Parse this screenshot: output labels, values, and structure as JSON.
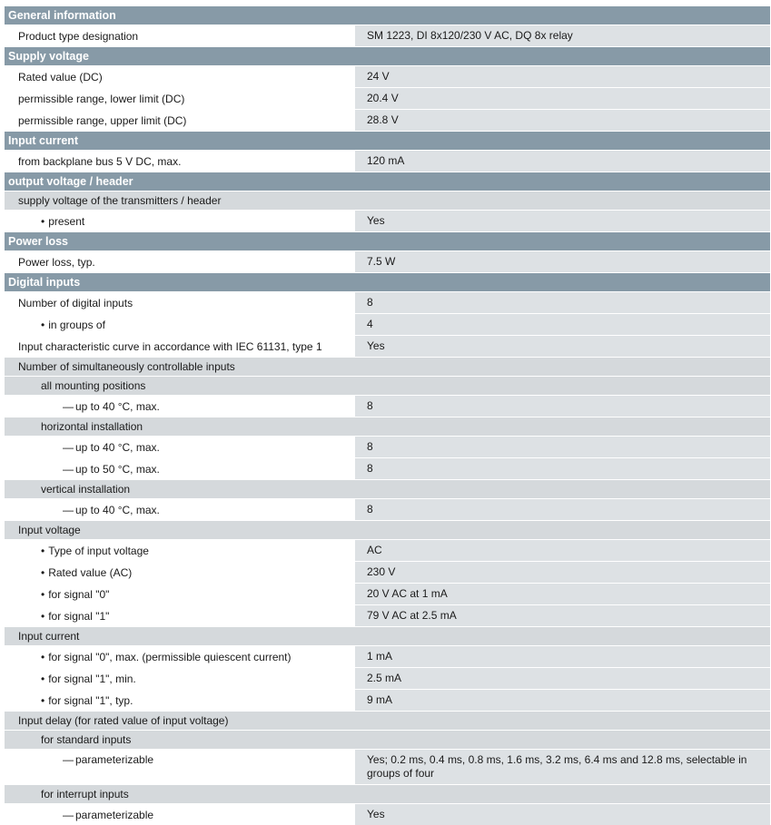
{
  "rows": [
    {
      "kind": "header",
      "label": "General information"
    },
    {
      "kind": "data",
      "label": "Product type designation",
      "value": "SM 1223, DI 8x120/230 V AC, DQ 8x relay"
    },
    {
      "kind": "header",
      "label": "Supply voltage"
    },
    {
      "kind": "data",
      "label": "Rated value (DC)",
      "value": "24 V"
    },
    {
      "kind": "data",
      "label": "permissible range, lower limit (DC)",
      "value": "20.4 V"
    },
    {
      "kind": "data",
      "label": "permissible range, upper limit (DC)",
      "value": "28.8 V"
    },
    {
      "kind": "header",
      "label": "Input current"
    },
    {
      "kind": "data",
      "label": "from backplane bus 5 V DC, max.",
      "value": "120 mA"
    },
    {
      "kind": "header",
      "label": "output voltage / header"
    },
    {
      "kind": "sub",
      "label": "supply voltage of the transmitters / header"
    },
    {
      "kind": "data",
      "indent": "bullet",
      "label": "present",
      "value": "Yes"
    },
    {
      "kind": "header",
      "label": "Power loss"
    },
    {
      "kind": "data",
      "label": "Power loss, typ.",
      "value": "7.5 W"
    },
    {
      "kind": "header",
      "label": "Digital inputs"
    },
    {
      "kind": "data",
      "label": "Number of digital inputs",
      "value": "8"
    },
    {
      "kind": "data",
      "indent": "bullet",
      "label": "in groups of",
      "value": "4"
    },
    {
      "kind": "data",
      "label": "Input characteristic curve in accordance with IEC 61131, type 1",
      "value": "Yes"
    },
    {
      "kind": "sub",
      "label": "Number of simultaneously controllable inputs"
    },
    {
      "kind": "sub",
      "indent": "lvl1",
      "label": "all mounting positions"
    },
    {
      "kind": "data",
      "indent": "dash",
      "label": "up to 40 °C, max.",
      "value": "8"
    },
    {
      "kind": "sub",
      "indent": "lvl1",
      "label": "horizontal installation"
    },
    {
      "kind": "data",
      "indent": "dash",
      "label": "up to 40 °C, max.",
      "value": "8"
    },
    {
      "kind": "data",
      "indent": "dash",
      "label": "up to 50 °C, max.",
      "value": "8"
    },
    {
      "kind": "sub",
      "indent": "lvl1",
      "label": "vertical installation"
    },
    {
      "kind": "data",
      "indent": "dash",
      "label": "up to 40 °C, max.",
      "value": "8"
    },
    {
      "kind": "sub",
      "label": "Input voltage"
    },
    {
      "kind": "data",
      "indent": "bullet",
      "label": "Type of input voltage",
      "value": "AC"
    },
    {
      "kind": "data",
      "indent": "bullet",
      "label": "Rated value (AC)",
      "value": "230 V"
    },
    {
      "kind": "data",
      "indent": "bullet",
      "label": "for signal \"0\"",
      "value": "20 V AC at 1 mA"
    },
    {
      "kind": "data",
      "indent": "bullet",
      "label": "for signal \"1\"",
      "value": "79 V AC at 2.5 mA"
    },
    {
      "kind": "sub",
      "label": "Input current"
    },
    {
      "kind": "data",
      "indent": "bullet",
      "label": "for signal \"0\", max. (permissible quiescent current)",
      "value": "1 mA"
    },
    {
      "kind": "data",
      "indent": "bullet",
      "label": "for signal \"1\", min.",
      "value": "2.5 mA"
    },
    {
      "kind": "data",
      "indent": "bullet",
      "label": "for signal \"1\", typ.",
      "value": "9 mA"
    },
    {
      "kind": "sub",
      "label": "Input delay (for rated value of input voltage)"
    },
    {
      "kind": "sub",
      "indent": "lvl1",
      "label": "for standard inputs"
    },
    {
      "kind": "data",
      "indent": "dash",
      "tall": true,
      "label": "parameterizable",
      "value": "Yes; 0.2 ms, 0.4 ms, 0.8 ms, 1.6 ms, 3.2 ms, 6.4 ms and 12.8 ms, selectable in groups of four"
    },
    {
      "kind": "sub",
      "indent": "lvl1",
      "label": "for interrupt inputs"
    },
    {
      "kind": "data",
      "indent": "dash",
      "label": "parameterizable",
      "value": "Yes"
    }
  ]
}
